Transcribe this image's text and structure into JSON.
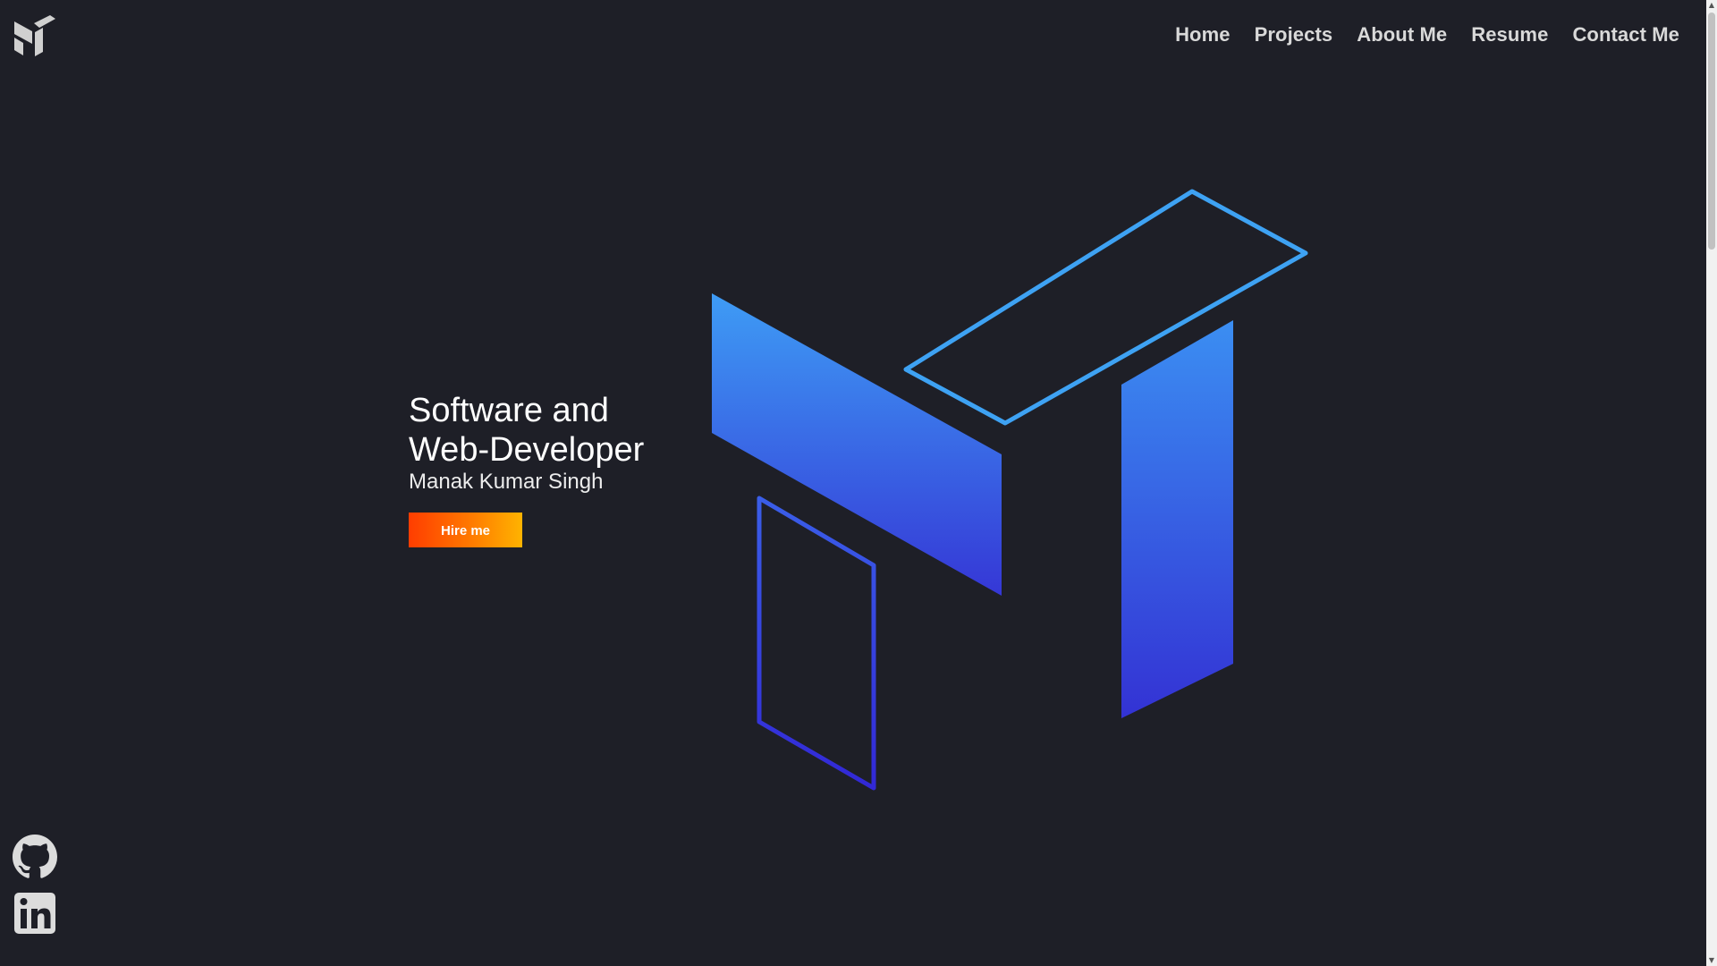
{
  "header": {
    "logo_icon": "brand-logo-icon",
    "nav": [
      {
        "label": "Home"
      },
      {
        "label": "Projects"
      },
      {
        "label": "About Me"
      },
      {
        "label": "Resume"
      },
      {
        "label": "Contact Me"
      }
    ]
  },
  "hero": {
    "title_line1": "Software and",
    "title_line2": "Web-Developer",
    "name": "Manak Kumar Singh",
    "hire_button": "Hire me",
    "art_icon": "brand-illustration"
  },
  "social": {
    "github_icon": "github-icon",
    "linkedin_icon": "linkedin-icon"
  },
  "colors": {
    "background": "#1e1f27",
    "accent_blue_top": "#3e9cf5",
    "accent_blue_bottom": "#3537d6",
    "button_gradient_start": "#ff3d00",
    "button_gradient_end": "#ffb300"
  }
}
